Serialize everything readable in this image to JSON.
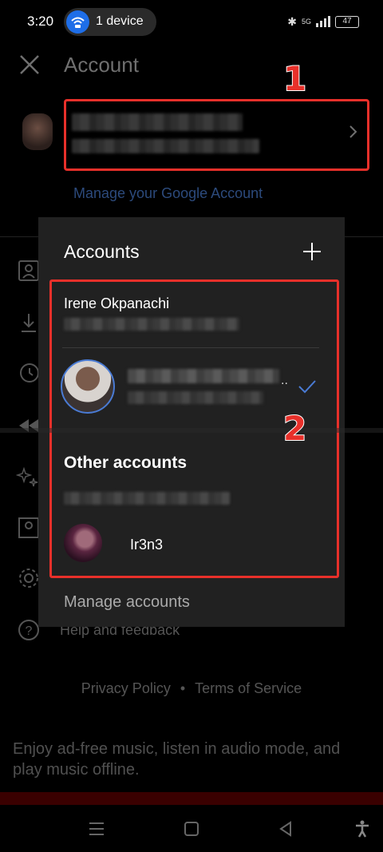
{
  "status_bar": {
    "time": "3:20",
    "device_pill": "1 device",
    "battery": "47",
    "network": "5G"
  },
  "account_page": {
    "title": "Account",
    "manage_google": "Manage your Google Account",
    "help": "Help and feedback",
    "footer": {
      "privacy": "Privacy Policy",
      "separator": "•",
      "terms": "Terms of Service"
    },
    "promo": "Enjoy ad-free music, listen in audio mode, and play music offline."
  },
  "annotations": {
    "label_1": "1",
    "label_2": "2",
    "color": "#e8302a"
  },
  "accounts_popup": {
    "title": "Accounts",
    "account_name": "Irene Okpanachi",
    "selected_ellipsis": "..",
    "other_accounts_title": "Other accounts",
    "other_account_name": "Ir3n3",
    "manage_accounts": "Manage accounts"
  },
  "icons": [
    "close-icon",
    "chevron-right-icon",
    "plus-icon",
    "checkmark-icon",
    "profile-icon",
    "download-icon",
    "history-icon",
    "rewind-icon",
    "sparkle-icon",
    "library-icon",
    "settings-icon",
    "help-icon",
    "menu-icon",
    "home-icon",
    "back-icon",
    "accessibility-icon"
  ]
}
